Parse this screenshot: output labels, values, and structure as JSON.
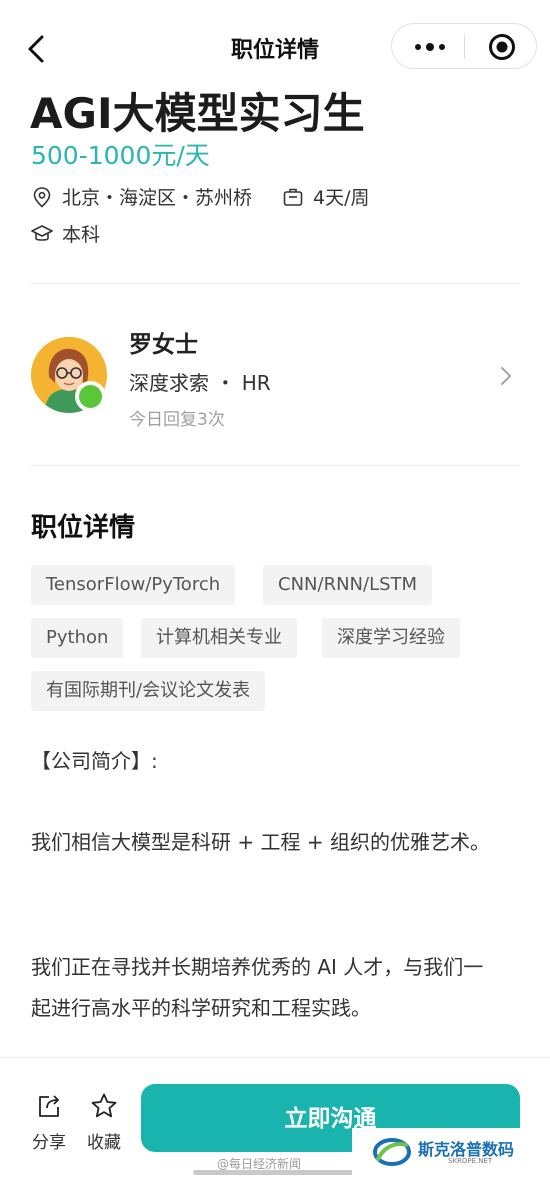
{
  "nav": {
    "title": "职位详情"
  },
  "job": {
    "title": "AGI大模型实习生",
    "salary": "500-1000元/天",
    "location": "北京・海淀区・苏州桥",
    "schedule": "4天/周",
    "education": "本科"
  },
  "recruiter": {
    "name": "罗女士",
    "company_role": "深度求索 ・ HR",
    "reply_info": "今日回复3次"
  },
  "details": {
    "section_title": "职位详情",
    "tags": [
      "TensorFlow/PyTorch",
      "CNN/RNN/LSTM",
      "Python",
      "计算机相关专业",
      "深度学习经验",
      "有国际期刊/会议论文发表"
    ],
    "intro_heading": "【公司简介】:",
    "paragraph_1": "我们相信大模型是科研 + 工程 + 组织的优雅艺术。",
    "paragraph_2": "我们正在寻找并长期培养优秀的 AI 人才，与我们一起进行高水平的科学研究和工程实践。"
  },
  "bottom_bar": {
    "share_label": "分享",
    "favorite_label": "收藏",
    "cta_label": "立即沟通"
  },
  "watermark": {
    "source": "@每日经济新闻",
    "brand": "斯克洛普数码",
    "brand_sub": "SKROPE.NET"
  },
  "colors": {
    "accent": "#18b4ad",
    "salary": "#2bb7b0",
    "online": "#5ac73a"
  }
}
